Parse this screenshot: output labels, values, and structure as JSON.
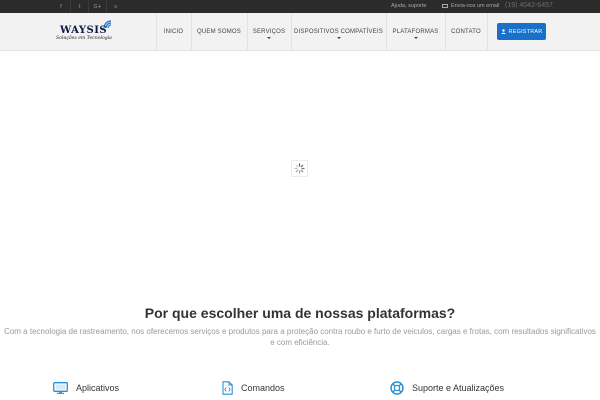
{
  "topbar": {
    "social": [
      {
        "glyph": "f"
      },
      {
        "glyph": "t"
      },
      {
        "glyph": "G+"
      },
      {
        "glyph": "s"
      }
    ],
    "help_label": "Ajuda, suporte",
    "email_label": "Envia-nos um email",
    "phone": "(19) 4042-6457"
  },
  "logo": {
    "name": "WAYSIS",
    "tagline": "Soluções em Tecnologia"
  },
  "nav": {
    "items": [
      {
        "label": "INICIO"
      },
      {
        "label": "QUEM SOMOS"
      },
      {
        "label": "SERVIÇOS"
      },
      {
        "label": "DISPOSITIVOS COMPATÍVEIS"
      },
      {
        "label": "PLATAFORMAS"
      },
      {
        "label": "CONTATO"
      }
    ],
    "register_label": "REGISTRAR"
  },
  "section": {
    "title": "Por que escolher uma de nossas plataformas?",
    "description": "Com a tecnologia de rastreamento, nos oferecemos serviços e produtos para a proteção contra roubo e furto de veiculos, cargas e frotas, com resultados significativos e com eficiência."
  },
  "features": [
    {
      "label": "Aplicativos",
      "icon": "monitor-icon"
    },
    {
      "label": "Comandos",
      "icon": "code-file-icon"
    },
    {
      "label": "Suporte e Atualizações",
      "icon": "lifebuoy-icon"
    }
  ],
  "colors": {
    "accent": "#1a6fc9",
    "topbar_bg": "#2b2b2b",
    "header_bg": "#f2f2f2",
    "feature_icon": "#2a8fd6"
  }
}
